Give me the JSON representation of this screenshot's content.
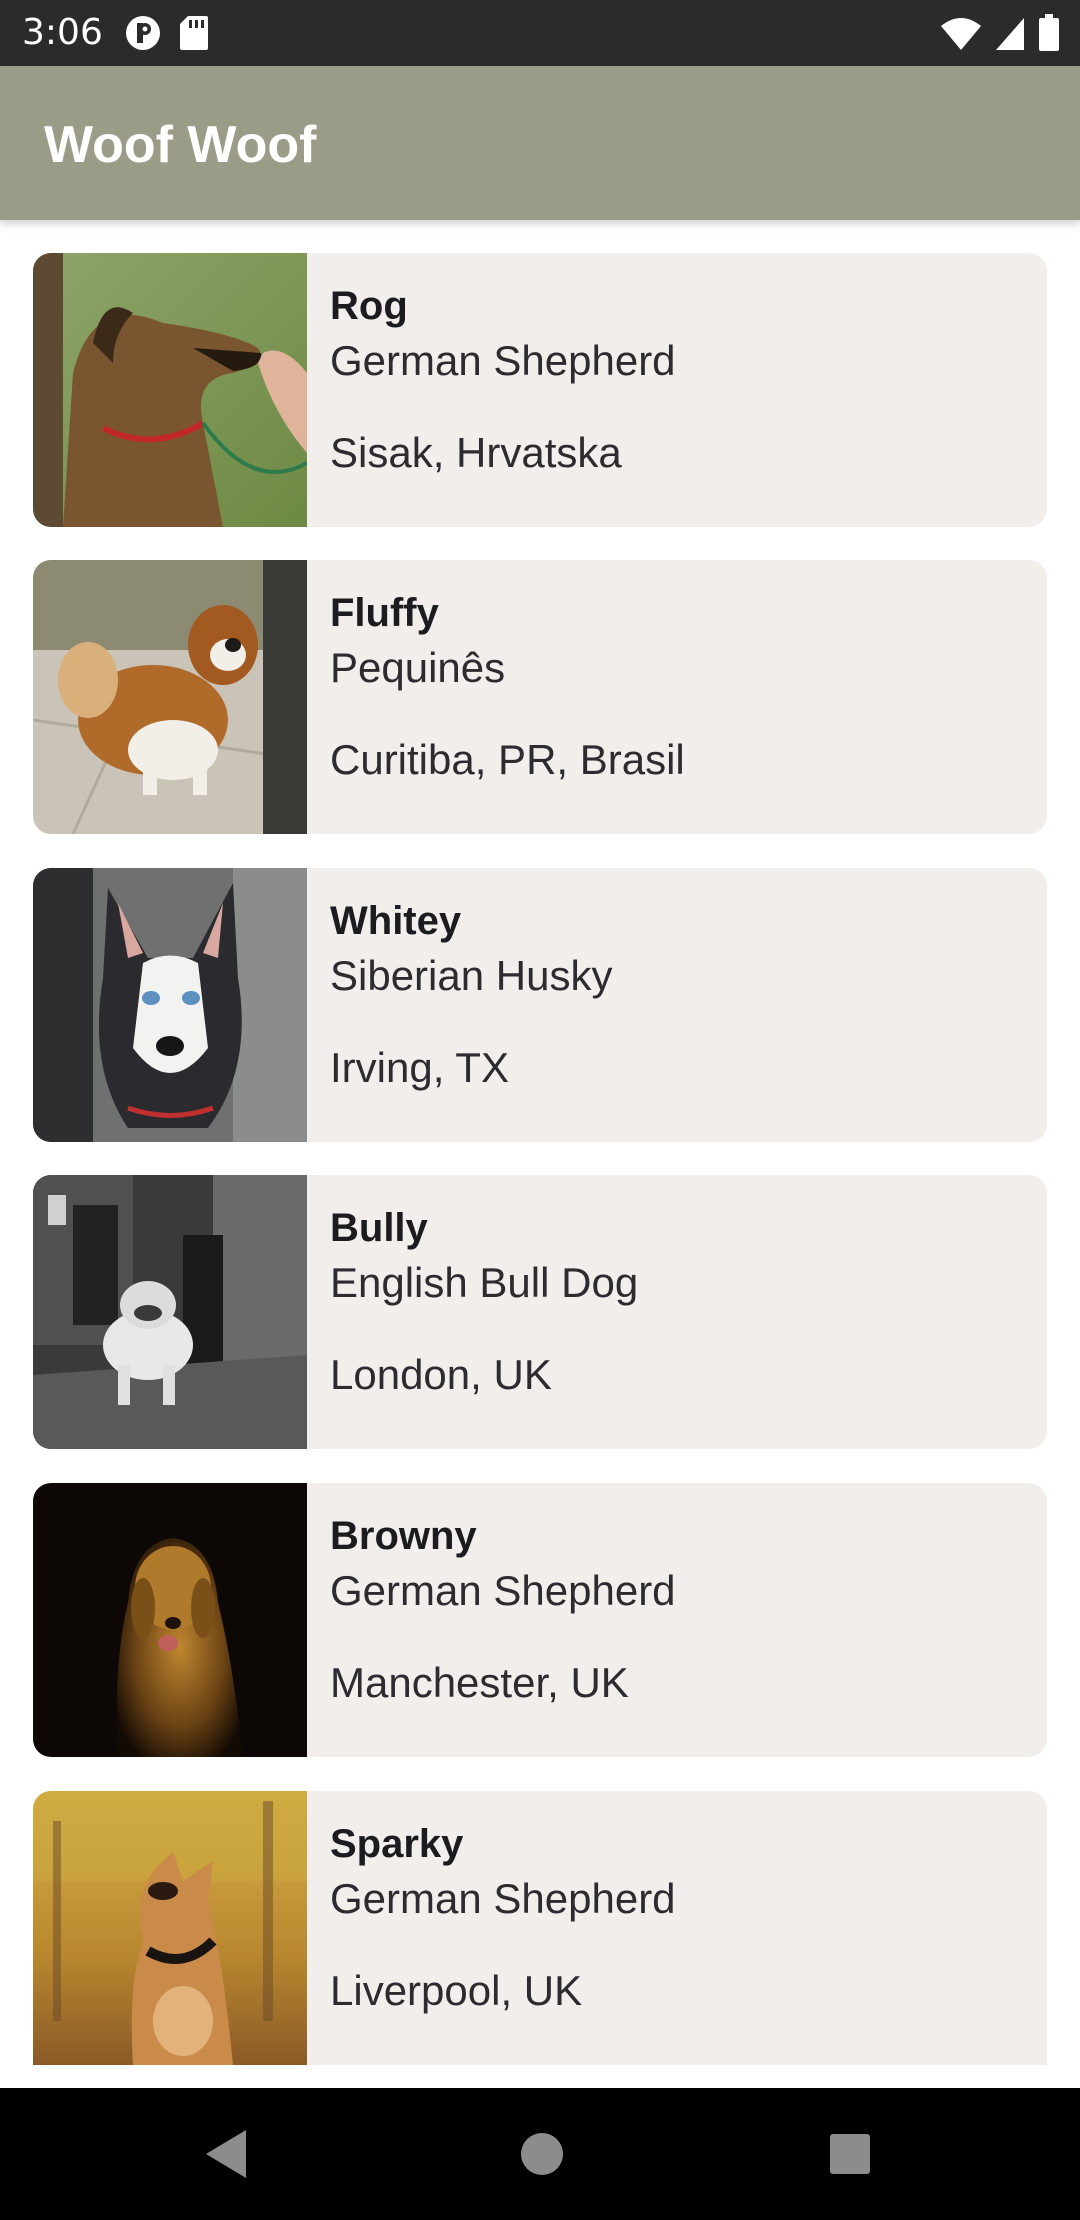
{
  "status_bar": {
    "time": "3:06",
    "icons_left": [
      "data-saver-icon",
      "sd-card-icon"
    ],
    "icons_right": [
      "wifi-icon",
      "cellular-signal-icon",
      "battery-icon"
    ]
  },
  "app_bar": {
    "title": "Woof Woof",
    "color": "#9a9c87"
  },
  "dogs": [
    {
      "name": "Rog",
      "breed": "German Shepherd",
      "location": "Sisak, Hrvatska",
      "photo": "dog-photo-german-shepherd"
    },
    {
      "name": "Fluffy",
      "breed": "Pequinês",
      "location": "Curitiba, PR, Brasil",
      "photo": "dog-photo-pekingese"
    },
    {
      "name": "Whitey",
      "breed": "Siberian Husky",
      "location": "Irving, TX",
      "photo": "dog-photo-husky"
    },
    {
      "name": "Bully",
      "breed": "English Bull Dog",
      "location": "London, UK",
      "photo": "dog-photo-bulldog"
    },
    {
      "name": "Browny",
      "breed": "German Shepherd",
      "location": "Manchester, UK",
      "photo": "dog-photo-golden"
    },
    {
      "name": "Sparky",
      "breed": "German Shepherd",
      "location": "Liverpool, UK",
      "photo": "dog-photo-tan-dog"
    }
  ],
  "nav_bar": {
    "buttons": [
      "back-icon",
      "home-icon",
      "recents-icon"
    ]
  },
  "colors": {
    "card_background": "#f2eeec",
    "status_bar": "#2b2b2b",
    "nav_bar": "#000000"
  }
}
